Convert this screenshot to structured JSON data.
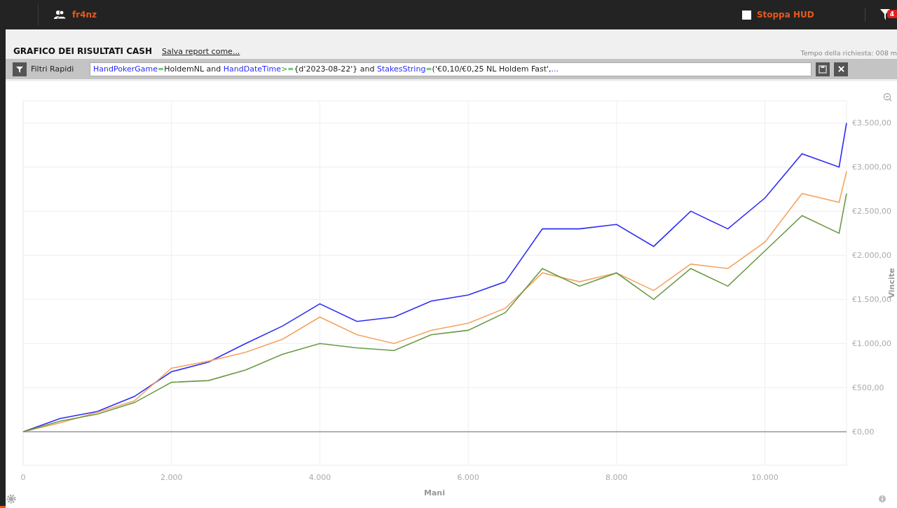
{
  "topbar": {
    "user": "fr4nz",
    "hud": {
      "label": "Stoppa HUD",
      "checked": false
    },
    "filter_badge": "4"
  },
  "report": {
    "title": "GRAFICO DEI RISULTATI CASH",
    "save_link": "Salva report come...",
    "query_time": "Tempo della richiesta: 008 m"
  },
  "quick_filters": {
    "label": "Filtri Rapidi",
    "tokens": [
      {
        "kind": "field",
        "text": "HandPokerGame"
      },
      {
        "kind": "op",
        "text": "="
      },
      {
        "kind": "text",
        "text": "HoldemNL and "
      },
      {
        "kind": "field",
        "text": "HandDateTime"
      },
      {
        "kind": "op",
        "text": ">="
      },
      {
        "kind": "text",
        "text": "{d'2023-08-22'} and "
      },
      {
        "kind": "field",
        "text": "StakesString"
      },
      {
        "kind": "op",
        "text": "="
      },
      {
        "kind": "text",
        "text": "('€0,10/€0,25 NL Holdem Fast',"
      },
      {
        "kind": "field",
        "text": "..."
      }
    ]
  },
  "chart": {
    "chart_data": {
      "type": "line",
      "grid": true,
      "xlabel": "Mani",
      "ylabel": "Vincite",
      "x": [
        0,
        500,
        1000,
        1500,
        2000,
        2500,
        3000,
        3500,
        4000,
        4500,
        5000,
        5500,
        6000,
        6500,
        7000,
        7500,
        8000,
        8500,
        9000,
        9500,
        10000,
        10500,
        11000,
        11100
      ],
      "xlim": [
        0,
        11100
      ],
      "ylim": [
        -380,
        3750
      ],
      "xticks": [
        {
          "value": 0,
          "label": "0"
        },
        {
          "value": 2000,
          "label": "2.000"
        },
        {
          "value": 4000,
          "label": "4.000"
        },
        {
          "value": 6000,
          "label": "6.000"
        },
        {
          "value": 8000,
          "label": "8.000"
        },
        {
          "value": 10000,
          "label": "10.000"
        }
      ],
      "yticks": [
        {
          "value": 0,
          "label": "€0,00"
        },
        {
          "value": 500,
          "label": "€500,00"
        },
        {
          "value": 1000,
          "label": "€1.000,00"
        },
        {
          "value": 1500,
          "label": "€1.500,00"
        },
        {
          "value": 2000,
          "label": "€2.000,00"
        },
        {
          "value": 2500,
          "label": "€2.500,00"
        },
        {
          "value": 3000,
          "label": "€3.000,00"
        },
        {
          "value": 3500,
          "label": "€3.500,00"
        }
      ],
      "series": [
        {
          "color": "#2d2df5",
          "values": [
            0,
            150,
            230,
            400,
            680,
            790,
            1000,
            1200,
            1450,
            1250,
            1300,
            1480,
            1550,
            1700,
            2300,
            2300,
            2350,
            2100,
            2500,
            2300,
            2650,
            3150,
            3000,
            3500
          ]
        },
        {
          "color": "#f5a461",
          "values": [
            0,
            100,
            220,
            350,
            720,
            800,
            900,
            1050,
            1300,
            1100,
            1000,
            1150,
            1230,
            1400,
            1800,
            1700,
            1800,
            1600,
            1900,
            1850,
            2150,
            2700,
            2600,
            2950
          ]
        },
        {
          "color": "#6a9a45",
          "values": [
            0,
            120,
            200,
            330,
            560,
            580,
            700,
            880,
            1000,
            950,
            920,
            1100,
            1150,
            1350,
            1850,
            1650,
            1800,
            1500,
            1850,
            1650,
            2050,
            2450,
            2250,
            2700
          ]
        }
      ]
    }
  }
}
